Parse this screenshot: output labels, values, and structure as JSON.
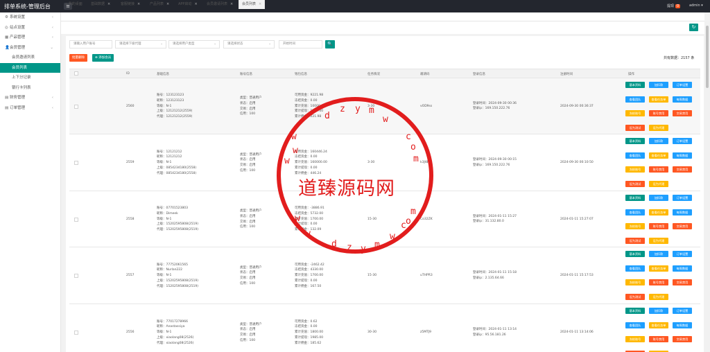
{
  "app": {
    "title": "排单系统-管理后台",
    "menu_icon": "≡",
    "notice_label": "提现",
    "notice_count": "0",
    "user": "admin ▾"
  },
  "sidebar": {
    "items": [
      {
        "icon": "⚙",
        "label": "系统设置",
        "arrow": "‹"
      },
      {
        "icon": "◎",
        "label": "站点设置",
        "arrow": "‹"
      },
      {
        "icon": "▦",
        "label": "产品管理",
        "arrow": "‹"
      },
      {
        "icon": "👤",
        "label": "会员管理",
        "arrow": "⌄"
      }
    ],
    "subs": [
      "会员邀请列表",
      "会员列表",
      "上下分记录",
      "银行卡列表"
    ],
    "items2": [
      {
        "icon": "▤",
        "label": "财务管理",
        "arrow": "‹"
      },
      {
        "icon": "▤",
        "label": "订单管理",
        "arrow": "‹"
      }
    ]
  },
  "tabs": [
    {
      "label": "⌂ 我的桌面"
    },
    {
      "label": "基础数据"
    },
    {
      "label": "客服链接"
    },
    {
      "label": "产品列表"
    },
    {
      "label": "APP启动"
    },
    {
      "label": "会员邀请列表"
    },
    {
      "label": "会员列表"
    }
  ],
  "tab_close": "×",
  "toolbar": {
    "refresh_icon": "↻"
  },
  "filters": {
    "user_placeholder": "请输入用户账号",
    "agent": "请选择下级代理",
    "type": "请选择用户类型",
    "status": "请选择状态",
    "date_placeholder": "开始时间",
    "search_icon": "🔍"
  },
  "actions": {
    "batch_delete": "批量删除",
    "add_member": "⊕ 添加会员",
    "total": "共有数据：2157 条"
  },
  "columns": [
    "ID",
    "基础信息",
    "账号信息",
    "钱包信息",
    "任务情况",
    "邀请码",
    "登录信息",
    "注册时间",
    "操作"
  ],
  "row_buttons": [
    "基本资料",
    "加扣款",
    "订单设置",
    "查看团队",
    "查看任务单",
    "每周数据",
    "冻结账号",
    "账号禁用",
    "交易禁用",
    "设为测试",
    "设为代理"
  ],
  "rows": [
    {
      "id": "2560",
      "basic": [
        "账号：123123123",
        "昵称：123123123",
        "等级：N-1",
        "上级：12121212(2559)",
        "代理：12121212(2559)"
      ],
      "account": [
        "类型：普通用户",
        "状态：启用",
        "交易：启用",
        "信用：100"
      ],
      "wallet": [
        "可用资金：9221.98",
        "冻结资金：0.00",
        "累计充值：10000.00",
        "累计提现：1000.00",
        "累计佣金：221.98"
      ],
      "task": "3-30",
      "code": "vOD9ss",
      "login": [
        "登录时间：2024-09-30 00:36",
        "登录ip：169.150.222.76"
      ],
      "reg": "2024-09-30 00:36:37"
    },
    {
      "id": "2559",
      "basic": [
        "账号：12121212",
        "昵称：12121212",
        "等级：N-1",
        "上级：0854234180(2558)",
        "代理：0854234180(2558)"
      ],
      "account": [
        "类型：普通用户",
        "状态：启用",
        "交易：启用",
        "信用：100"
      ],
      "wallet": [
        "可用资金：160446.24",
        "冻结资金：0.00",
        "累计充值：160000.00",
        "累计提现：0.00",
        "累计佣金：446.24"
      ],
      "task": "3-30",
      "code": "k3Jt8f",
      "login": [
        "登录时间：2024-09-30 00:15",
        "登录ip：169.150.222.76"
      ],
      "reg": "2024-09-30 00:10:50"
    },
    {
      "id": "2558",
      "basic": [
        "账号：07701523803",
        "昵称：Dimeek",
        "等级：N-1",
        "上级：15202595808(2519)",
        "代理：15202595808(2519)"
      ],
      "account": [
        "类型：普通用户",
        "状态：启用",
        "交易：启用",
        "信用：100"
      ],
      "wallet": [
        "可用资金：-3886.91",
        "冻结资金：5732.00",
        "累计充值：1700.00",
        "累计提现：0.00",
        "累计佣金：132.09"
      ],
      "task": "15-30",
      "code": "Co32ZK",
      "login": [
        "登录时间：2024-01-11 15:27",
        "登录ip：31.132.80.0"
      ],
      "reg": "2024-01-11 15:27:07"
    },
    {
      "id": "2557",
      "basic": [
        "账号：77752061565",
        "昵称：Nurlan222",
        "等级：N-1",
        "上级：15202595808(2519)",
        "代理：15202595808(2519)"
      ],
      "account": [
        "类型：普通用户",
        "状态：启用",
        "交易：启用",
        "信用：100"
      ],
      "wallet": [
        "可用资金：-2462.42",
        "冻结资金：4330.00",
        "累计充值：1700.00",
        "累计提现：0.00",
        "累计佣金：167.50"
      ],
      "task": "15-30",
      "code": "uTHPR3",
      "login": [
        "登录时间：2024-01-11 15:18",
        "登录ip：2.135.64.66"
      ],
      "reg": "2024-01-11 15:17:53"
    },
    {
      "id": "2556",
      "basic": [
        "账号：77017278966",
        "昵称：Anastassiya",
        "等级：N-1",
        "上级：xiaolang08(2526)",
        "代理：xiaolang08(2526)"
      ],
      "account": [
        "类型：普通用户",
        "状态：启用",
        "交易：启用",
        "信用：100"
      ],
      "wallet": [
        "可用资金：0.62",
        "冻结资金：0.00",
        "累计充值：1800.00",
        "累计提现：1985.00",
        "累计佣金：185.62"
      ],
      "task": "30-30",
      "code": "z5MTJ9",
      "login": [
        "登录时间：2024-01-11 13:14",
        "登录ip：95.56.181.26"
      ],
      "reg": "2024-01-11 13:14:06"
    }
  ],
  "watermark": {
    "text": "道臻源码网",
    "top": "w.dzymw.com",
    "bottom": "w.dzymw.com"
  }
}
